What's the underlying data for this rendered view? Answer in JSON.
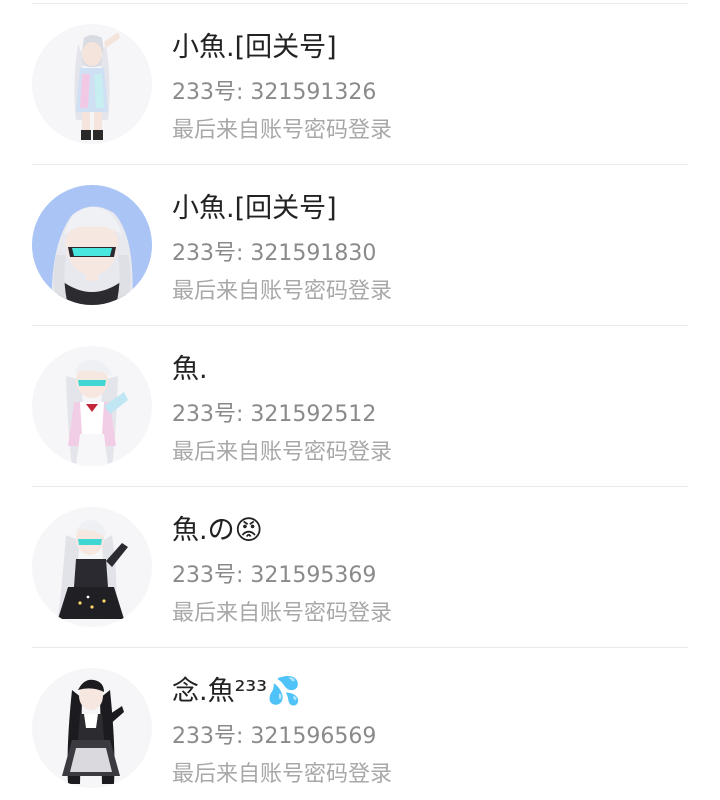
{
  "accounts": [
    {
      "name": "小魚.[回关号]",
      "uid": "233号: 321591326",
      "login": "最后来自账号密码登录",
      "avatar_icon": "anime-girl-avatar-icon"
    },
    {
      "name": "小魚.[回关号]",
      "uid": "233号: 321591830",
      "login": "最后来自账号密码登录",
      "avatar_icon": "anime-girl-visor-avatar-icon"
    },
    {
      "name": "魚.",
      "uid": "233号: 321592512",
      "login": "最后来自账号密码登录",
      "avatar_icon": "anime-girl-avatar-icon"
    },
    {
      "name": "魚.の😡",
      "uid": "233号: 321595369",
      "login": "最后来自账号密码登录",
      "avatar_icon": "anime-girl-avatar-icon"
    },
    {
      "name": "念.魚²³³💦",
      "uid": "233号: 321596569",
      "login": "最后来自账号密码登录",
      "avatar_icon": "anime-girl-avatar-icon"
    }
  ],
  "colors": {
    "name_text": "#222222",
    "uid_text": "#8a8a8a",
    "login_text": "#a8a8a8",
    "divider": "#e9e9e9",
    "avatar_blue_bg": "#a9c4f5"
  }
}
